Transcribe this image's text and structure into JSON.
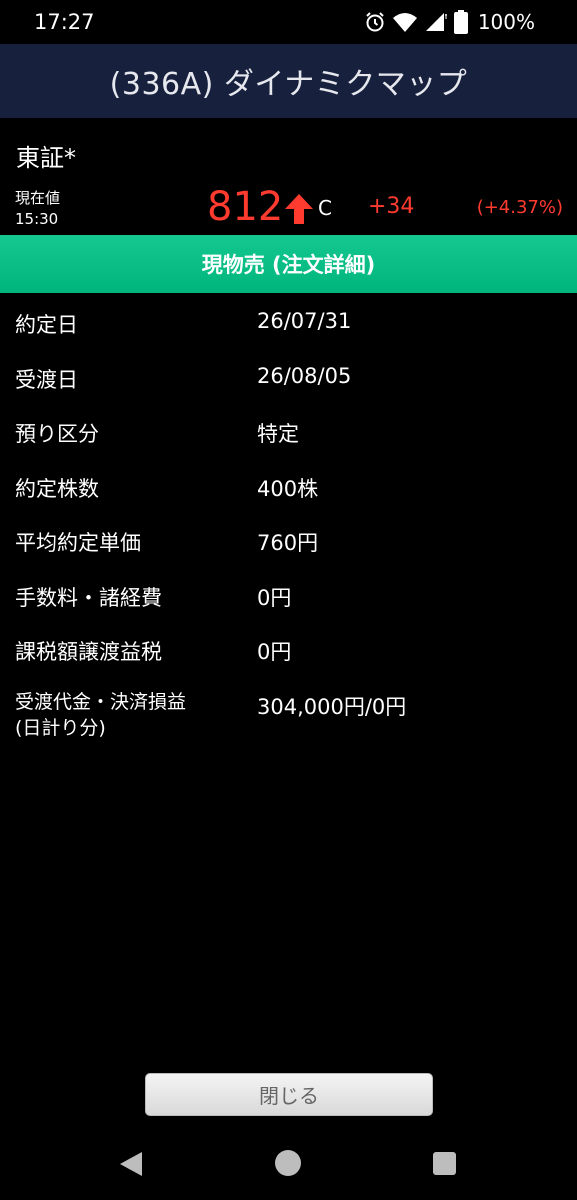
{
  "status_bar": {
    "time": "17:27",
    "battery_text": "100%",
    "icons": [
      "alarm-icon",
      "wifi-icon",
      "signal-icon",
      "battery-icon"
    ]
  },
  "header": {
    "title": "(336A) ダイナミクマップ"
  },
  "market": {
    "name": "東証*"
  },
  "price": {
    "label_line1": "現在値",
    "label_line2": "15:30",
    "value": "812",
    "trend_icon": "up-arrow-icon",
    "suffix": "C",
    "change": "+34",
    "change_pct": "(+4.37%)",
    "color_up": "#ff3b30"
  },
  "section": {
    "title": "現物売 (注文詳細)",
    "color": "#00b57c"
  },
  "details": [
    {
      "label": "約定日",
      "value": "26/07/31"
    },
    {
      "label": "受渡日",
      "value": "26/08/05"
    },
    {
      "label": "預り区分",
      "value": "特定"
    },
    {
      "label": "約定株数",
      "value": "400株"
    },
    {
      "label": "平均約定単価",
      "value": "760円"
    },
    {
      "label": "手数料・諸経費",
      "value": "0円"
    },
    {
      "label": "課税額譲渡益税",
      "value": "0円"
    },
    {
      "label": "受渡代金・決済損益",
      "label2": "(日計り分)",
      "value": "304,000円/0円"
    }
  ],
  "footer": {
    "close_label": "閉じる"
  },
  "nav": {
    "icons": [
      "back-icon",
      "home-icon",
      "recent-apps-icon"
    ]
  }
}
